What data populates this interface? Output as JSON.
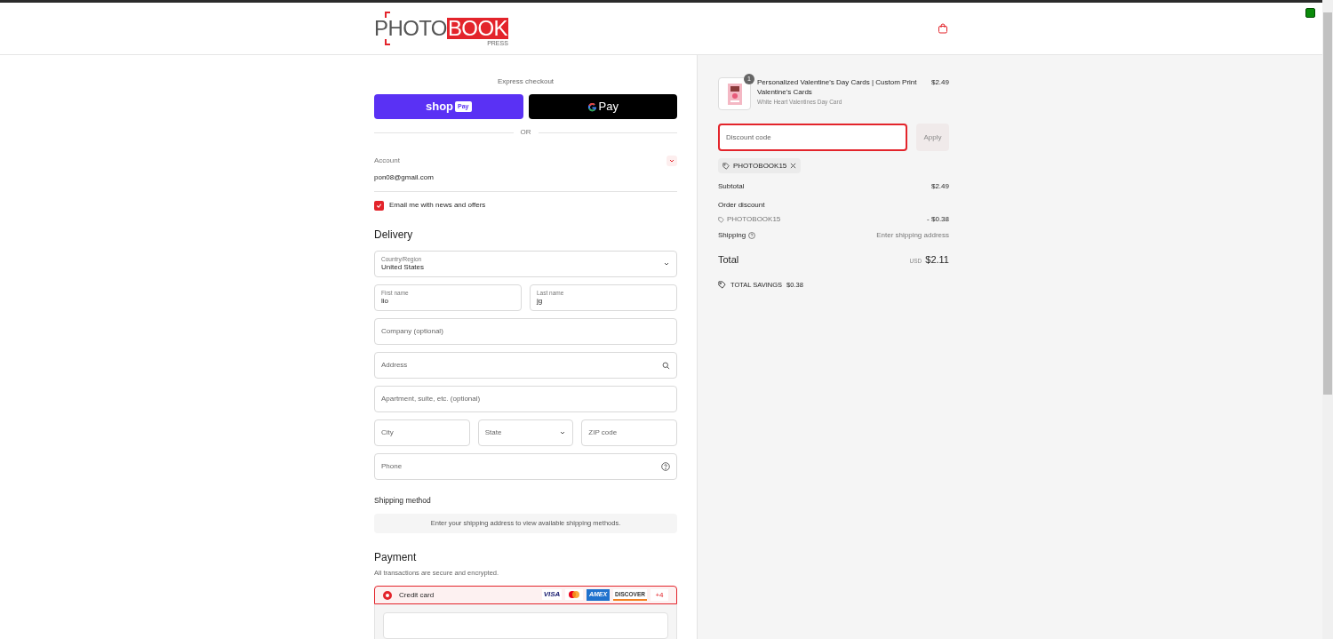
{
  "header": {
    "logo": {
      "word_1": "PHOTO",
      "word_2": "BOOK",
      "tagline": "PRESS"
    }
  },
  "express_checkout": {
    "title": "Express checkout",
    "buttons": [
      {
        "kind": "shop_pay",
        "label": "shop",
        "badge": "Pay"
      },
      {
        "kind": "google_pay",
        "label": "Pay"
      }
    ],
    "divider": "OR"
  },
  "account": {
    "label": "Account",
    "email": "pon08@gmail.com"
  },
  "newsletter": {
    "label": "Email me with news and offers",
    "checked": true
  },
  "delivery": {
    "title": "Delivery",
    "rows": [
      [
        {
          "kind": "select",
          "label": "Country/Region",
          "value": "United States"
        }
      ],
      [
        {
          "kind": "text",
          "label": "First name",
          "value": "lio"
        },
        {
          "kind": "text",
          "label": "Last name",
          "value": "jg"
        }
      ],
      [
        {
          "kind": "text",
          "placeholder": "Company (optional)"
        }
      ],
      [
        {
          "kind": "search",
          "placeholder": "Address"
        }
      ],
      [
        {
          "kind": "text",
          "placeholder": "Apartment, suite, etc. (optional)"
        }
      ],
      [
        {
          "kind": "text",
          "placeholder": "City"
        },
        {
          "kind": "select",
          "placeholder": "State"
        },
        {
          "kind": "text",
          "placeholder": "ZIP code"
        }
      ],
      [
        {
          "kind": "help",
          "placeholder": "Phone"
        }
      ]
    ]
  },
  "shipping_method": {
    "title": "Shipping method",
    "message": "Enter your shipping address to view available shipping methods."
  },
  "payment": {
    "title": "Payment",
    "subtitle": "All transactions are secure and encrypted.",
    "methods": [
      {
        "label": "Credit card",
        "selected": true,
        "brands": [
          {
            "kind": "visa",
            "label": "VISA"
          },
          {
            "kind": "mastercard"
          },
          {
            "kind": "amex",
            "label": "AMEX"
          },
          {
            "kind": "discover",
            "label": "DISCOVER"
          }
        ],
        "more": "+4"
      }
    ]
  },
  "order_summary": {
    "items": [
      {
        "quantity": "1",
        "title": "Personalized Valentine's Day Cards | Custom Print Valentine's Cards",
        "variant": "White Heart Valentines Day Card",
        "price": "$2.49"
      }
    ],
    "discount": {
      "placeholder": "Discount code",
      "apply": "Apply"
    },
    "applied_codes": [
      {
        "code": "PHOTOBOOK15"
      }
    ],
    "subtotal": {
      "label": "Subtotal",
      "value": "$2.49"
    },
    "order_discount": {
      "label": "Order discount",
      "code": "PHOTOBOOK15",
      "value": "- $0.38"
    },
    "shipping": {
      "label": "Shipping",
      "value": "Enter shipping address"
    },
    "total": {
      "label": "Total",
      "currency": "USD",
      "value": "$2.11"
    },
    "savings": {
      "label": "TOTAL SAVINGS",
      "value": "$0.38"
    }
  }
}
